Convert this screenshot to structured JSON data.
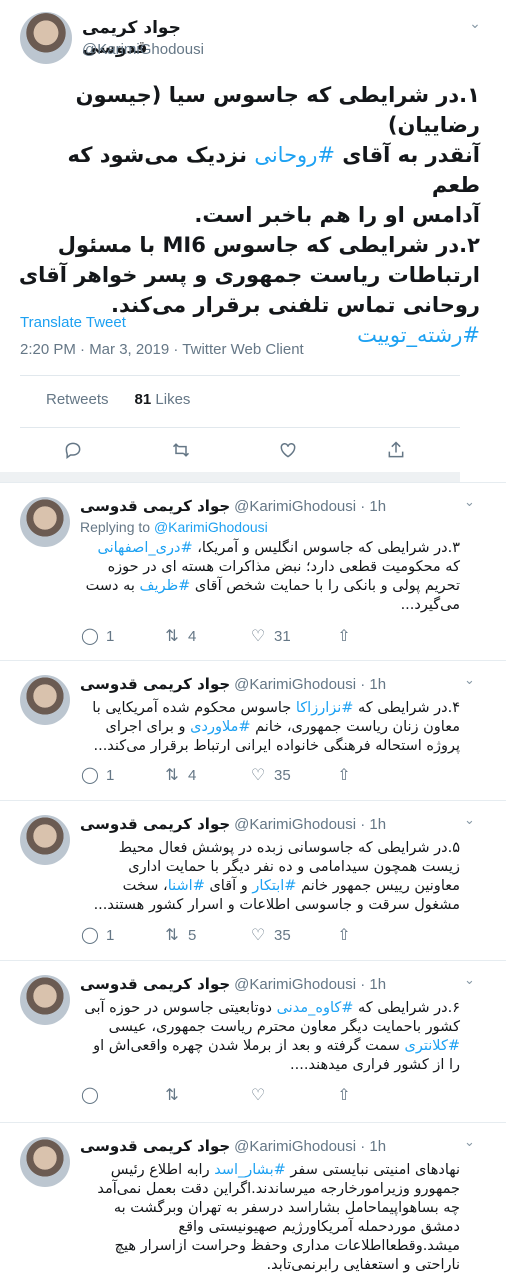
{
  "main_tweet": {
    "author_name": "جواد کریمی قدوسی",
    "handle": "@KarimiGhodousi",
    "line1": "۱.در شرایطی که جاسوس سیا (جیسون رضاییان)",
    "line2a": "آنقدر به آقای ",
    "line2_hashtag": "#روحانی",
    "line2b": " نزدیک می‌شود که طعم",
    "line3": "آدامس او را هم باخبر است.",
    "line4": "۲.در شرایطی که جاسوس MI6 با مسئول",
    "line5": "ارتباطات ریاست جمهوری و پسر خواهر آقای",
    "line6": "روحانی تماس تلفنی برقرار می‌کند.",
    "hashtag_footer": "#رشته_توییت",
    "translate_label": "Translate Tweet",
    "timestamp": "2:20 PM · Mar 3, 2019 · Twitter Web Client",
    "retweets_label": "Retweets",
    "likes_count": "81",
    "likes_label": "Likes"
  },
  "replies": [
    {
      "name": "جواد کریمی قدوسی",
      "handle": "@KarimiGhodousi · 1h",
      "replying_prefix": "Replying to ",
      "replying_handle": "@KarimiGhodousi",
      "text_a": "۳.در شرایطی که جاسوس انگلیس و آمریکا، ",
      "hashtag1": "#دری_اصفهانی",
      "text_b": " که محکومیت قطعی دارد؛ نبض مذاکرات هسته ای در حوزه تحریم پولی و بانکی را با حمایت شخص آقای ",
      "hashtag2": "#ظریف",
      "text_c": " به دست می‌گیرد...",
      "replies": "1",
      "retweets": "4",
      "likes": "31"
    },
    {
      "name": "جواد کریمی قدوسی",
      "handle": "@KarimiGhodousi · 1h",
      "text_a": "۴.در شرایطی که ",
      "hashtag1": "#نزارزاکا",
      "text_b": " جاسوس محکوم شده آمریکایی با معاون زنان ریاست جمهوری، خانم ",
      "hashtag2": "#ملاوردی",
      "text_c": " و برای اجرای پروژه استحاله فرهنگی خانواده ایرانی ارتباط برقرار می‌کند...",
      "replies": "1",
      "retweets": "4",
      "likes": "35"
    },
    {
      "name": "جواد کریمی قدوسی",
      "handle": "@KarimiGhodousi · 1h",
      "text_a": "۵.در شرایطی که جاسوسانی زبده در پوشش فعال محیط زیست همچون سیدامامی و ده نفر دیگر با حمایت اداری معاونین رییس جمهور خانم ",
      "hashtag1": "#ابتکار",
      "text_b": " و آقای ",
      "hashtag2": "#اشنا",
      "text_c": "، سخت مشغول سرقت و جاسوسی اطلاعات و اسرار کشور هستند...",
      "replies": "1",
      "retweets": "5",
      "likes": "35"
    },
    {
      "name": "جواد کریمی قدوسی",
      "handle": "@KarimiGhodousi · 1h",
      "text_a": "۶.در شرایطی که ",
      "hashtag1": "#کاوه_مدنی",
      "text_b": " دوتابعیتی جاسوس در حوزه آبی کشور باحمایت دیگر معاون محترم ریاست جمهوری، عیسی ",
      "hashtag2": "#کلانتری",
      "text_c": " سمت گرفته و بعد از برملا شدن چهره واقعی‌اش او را از کشور فراری میدهند....",
      "replies": "",
      "retweets": "",
      "likes": ""
    },
    {
      "name": "جواد کریمی قدوسی",
      "handle": "@KarimiGhodousi · 1h",
      "text_a": "نهادهای امنیتی نبایستی سفر ",
      "hashtag1": "#بشار_اسد",
      "text_b": " رابه اطلاع رئیس جمهورو وزیرامورخارجه میرساندند.اگراین دقت بعمل نمی‌آمد چه بساهواپیماحامل بشاراسد درسفر به تهران وبرگشت به دمشق موردحمله آمریکاورژیم صهیونیستی واقع میشد.وقطعااطلاعات مداری وحفظ وحراست ازاسرار هیچ ناراحتی و استعفایی رابرنمی‌تابد.",
      "hashtag2": "",
      "text_c": "",
      "replies": "",
      "retweets": "",
      "likes": ""
    }
  ],
  "colors": {
    "link": "#1da1f2",
    "muted": "#657786",
    "divider": "#e1e8ed"
  },
  "icons": [
    "reply-icon",
    "retweet-icon",
    "like-icon",
    "share-icon",
    "chevron-down-icon"
  ]
}
